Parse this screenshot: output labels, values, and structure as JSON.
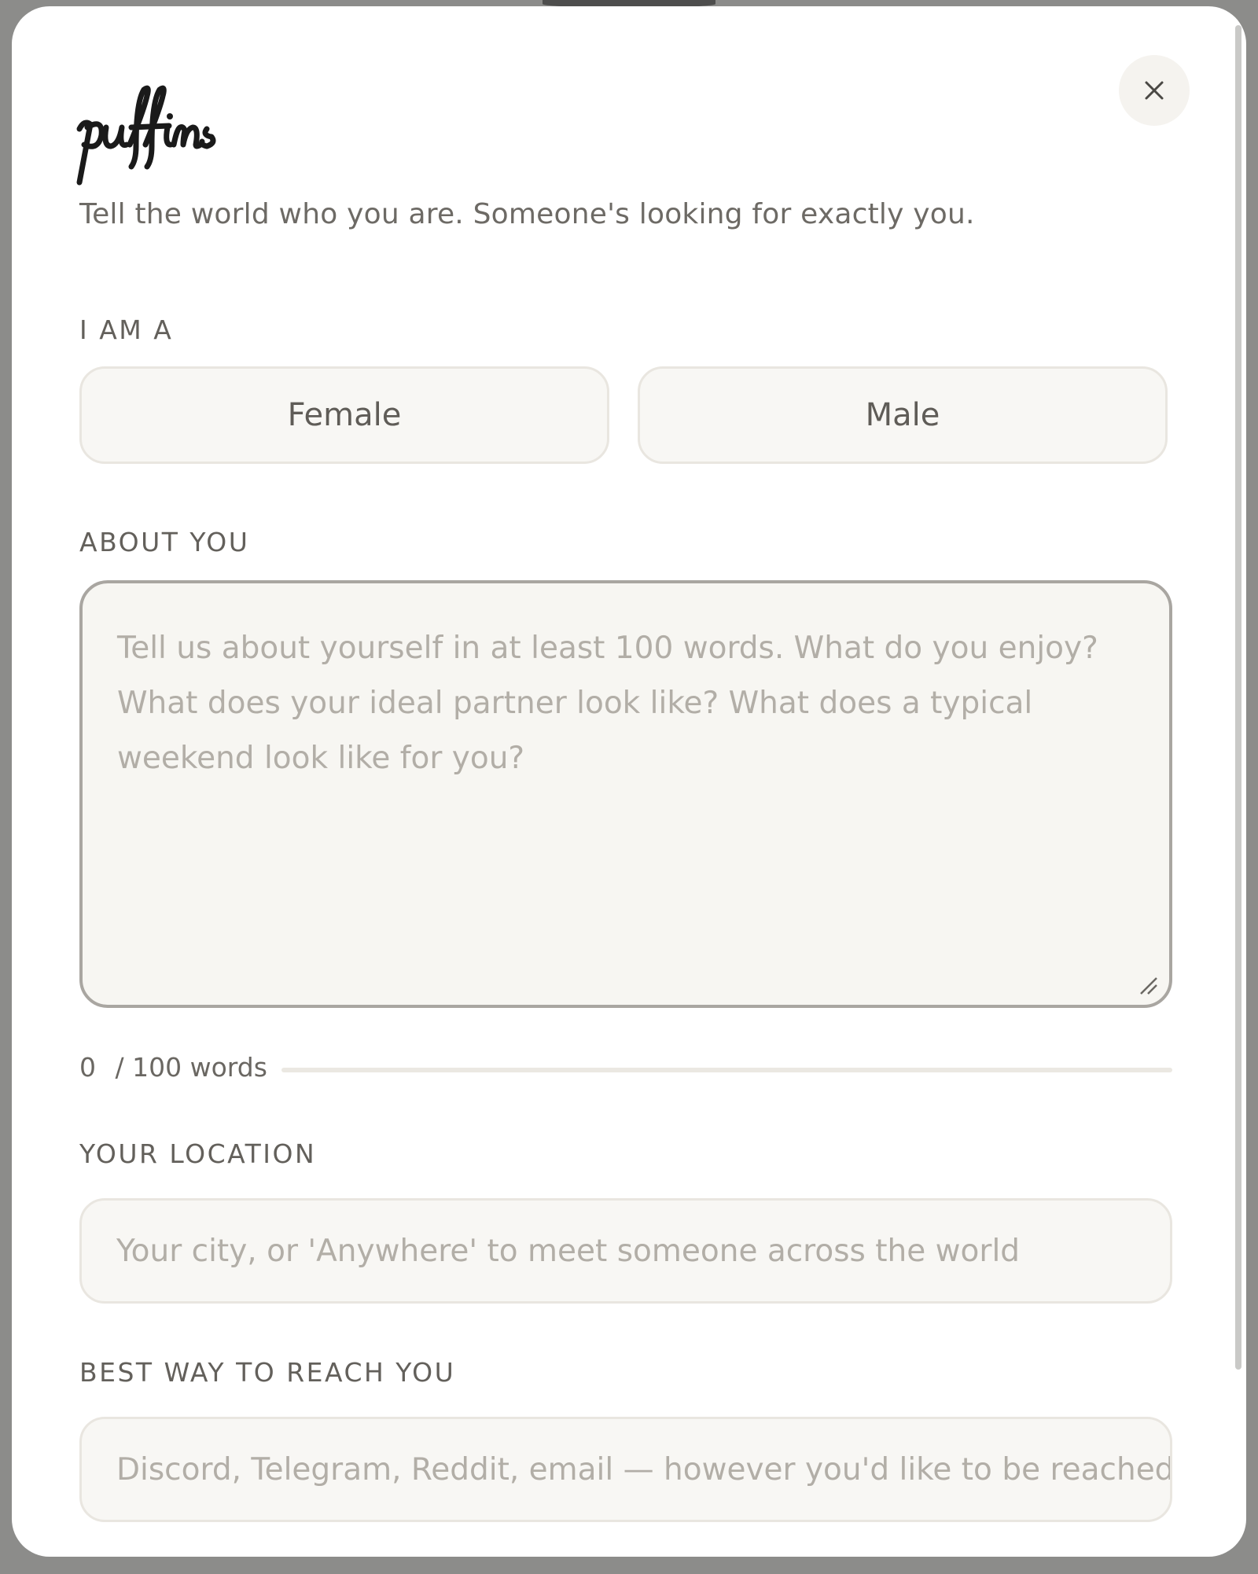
{
  "app": {
    "logo_text": "puffins",
    "tagline": "Tell the world who you are. Someone's looking for exactly you."
  },
  "close_button": {
    "glyph": "×",
    "icon": "close-icon"
  },
  "gender": {
    "label": "I AM A",
    "options": [
      "Female",
      "Male"
    ]
  },
  "about": {
    "label": "ABOUT YOU",
    "value": "",
    "placeholder": "Tell us about yourself in at least 100 words. What do you enjoy? What does your ideal partner look like? What does a typical weekend look like for you?",
    "word_count": "0",
    "word_count_suffix": "/ 100 words",
    "progress": 0
  },
  "location": {
    "label": "YOUR LOCATION",
    "value": "",
    "placeholder": "Your city, or 'Anywhere' to meet someone across the world"
  },
  "contact": {
    "label": "BEST WAY TO REACH YOU",
    "value": "",
    "placeholder": "Discord, Telegram, Reddit, email — however you'd like to be reached"
  },
  "colors": {
    "backdrop": "#8c8c8a",
    "modal": "#ffffff",
    "field_background": "#f8f7f4",
    "label_text": "#63605b",
    "placeholder_text": "#b2aea7"
  }
}
